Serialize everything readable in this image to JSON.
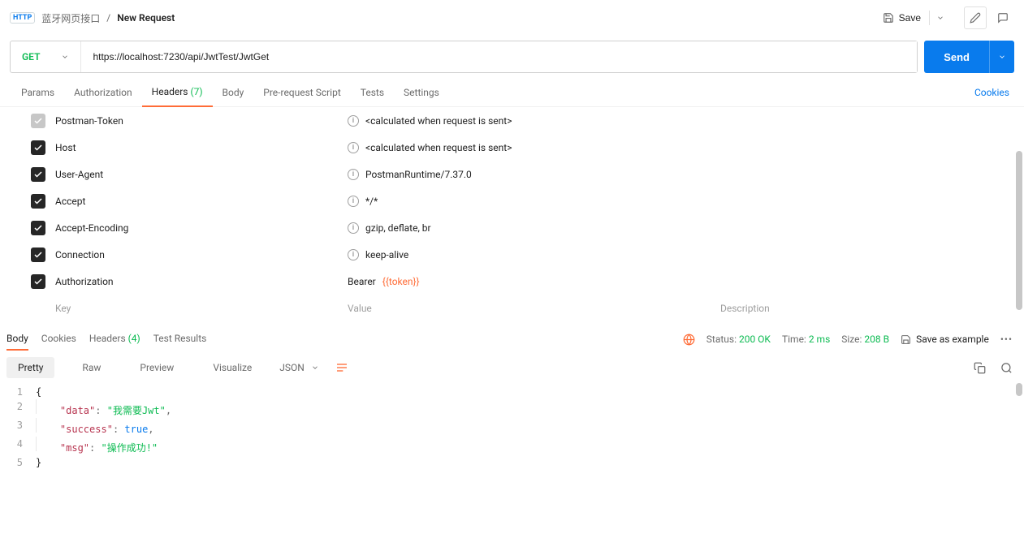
{
  "breadcrumb": {
    "collection": "蓝牙网页接口",
    "current": "New Request"
  },
  "topbar": {
    "save": "Save"
  },
  "request": {
    "method": "GET",
    "url": "https://localhost:7230/api/JwtTest/JwtGet",
    "send": "Send"
  },
  "req_tabs": {
    "params": "Params",
    "auth": "Authorization",
    "headers": "Headers",
    "headers_count": "(7)",
    "body": "Body",
    "pre": "Pre-request Script",
    "tests": "Tests",
    "settings": "Settings",
    "cookies": "Cookies"
  },
  "headers": [
    {
      "enabled": false,
      "key": "Postman-Token",
      "info": true,
      "value": "<calculated when request is sent>"
    },
    {
      "enabled": true,
      "key": "Host",
      "info": true,
      "value": "<calculated when request is sent>"
    },
    {
      "enabled": true,
      "key": "User-Agent",
      "info": true,
      "value": "PostmanRuntime/7.37.0"
    },
    {
      "enabled": true,
      "key": "Accept",
      "info": true,
      "value": "*/*"
    },
    {
      "enabled": true,
      "key": "Accept-Encoding",
      "info": true,
      "value": "gzip, deflate, br"
    },
    {
      "enabled": true,
      "key": "Connection",
      "info": true,
      "value": "keep-alive"
    },
    {
      "enabled": true,
      "key": "Authorization",
      "info": false,
      "value_prefix": "Bearer ",
      "value_var": "{{token}}"
    }
  ],
  "headers_placeholder": {
    "key": "Key",
    "value": "Value",
    "desc": "Description"
  },
  "resp_tabs": {
    "body": "Body",
    "cookies": "Cookies",
    "headers": "Headers",
    "headers_count": "(4)",
    "tests": "Test Results"
  },
  "resp_status": {
    "status_lbl": "Status:",
    "status_val": "200 OK",
    "time_lbl": "Time:",
    "time_val": "2 ms",
    "size_lbl": "Size:",
    "size_val": "208 B",
    "save_example": "Save as example"
  },
  "body_toolbar": {
    "pretty": "Pretty",
    "raw": "Raw",
    "preview": "Preview",
    "visualize": "Visualize",
    "format": "JSON"
  },
  "json_body": {
    "l1": "{",
    "l2_key": "\"data\"",
    "l2_val": "\"我需要Jwt\"",
    "l3_key": "\"success\"",
    "l3_val": "true",
    "l4_key": "\"msg\"",
    "l4_val": "\"操作成功!\"",
    "l5": "}"
  }
}
